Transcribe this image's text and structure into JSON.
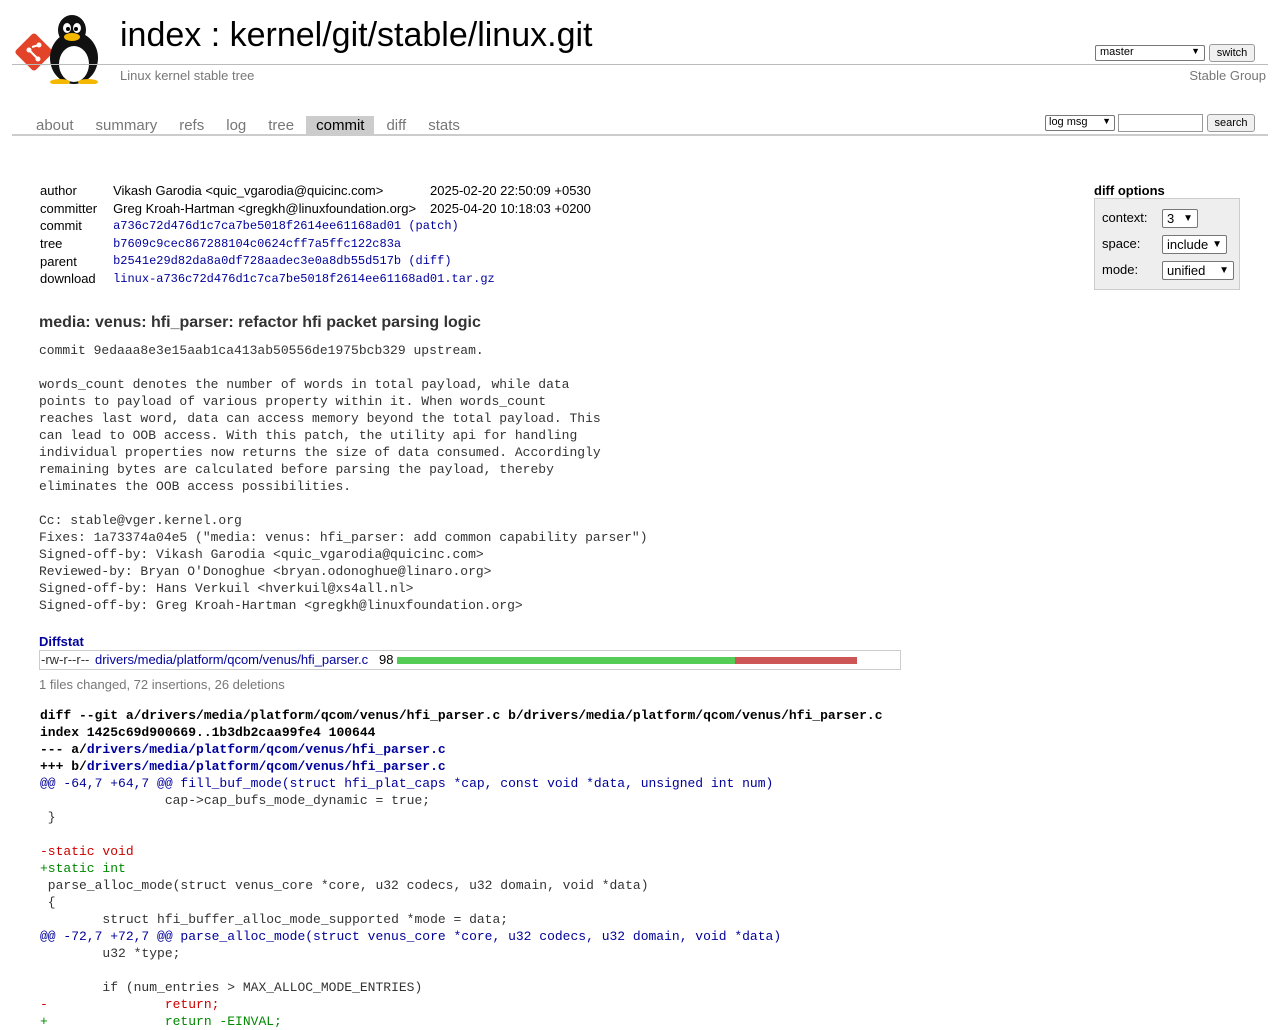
{
  "header": {
    "title_index": "index",
    "title_sep": " : ",
    "title_repo": "kernel/git/stable/linux.git",
    "subtitle": "Linux kernel stable tree",
    "owner": "Stable Group",
    "branch": "master",
    "switch_label": "switch"
  },
  "tabs": [
    {
      "label": "about"
    },
    {
      "label": "summary"
    },
    {
      "label": "refs"
    },
    {
      "label": "log"
    },
    {
      "label": "tree"
    },
    {
      "label": "commit",
      "active": true
    },
    {
      "label": "diff"
    },
    {
      "label": "stats"
    }
  ],
  "search": {
    "type": "log msg",
    "query": "",
    "button": "search"
  },
  "commit_info": [
    {
      "label": "author",
      "value": "Vikash Garodia <quic_vgarodia@quicinc.com>",
      "date": "2025-02-20 22:50:09 +0530"
    },
    {
      "label": "committer",
      "value": "Greg Kroah-Hartman <gregkh@linuxfoundation.org>",
      "date": "2025-04-20 10:18:03 +0200"
    },
    {
      "label": "commit",
      "hash": "a736c72d476d1c7ca7be5018f2614ee61168ad01",
      "extra": "(patch)"
    },
    {
      "label": "tree",
      "hash": "b7609c9cec867288104c0624cff7a5ffc122c83a"
    },
    {
      "label": "parent",
      "hash": "b2541e29d82da8a0df728aadec3e0a8db55d517b",
      "extra": "(diff)"
    },
    {
      "label": "download",
      "hash": "linux-a736c72d476d1c7ca7be5018f2614ee61168ad01.tar.gz"
    }
  ],
  "diff_options": {
    "title": "diff options",
    "context_label": "context:",
    "context_value": "3",
    "space_label": "space:",
    "space_value": "include",
    "mode_label": "mode:",
    "mode_value": "unified"
  },
  "subject": "media: venus: hfi_parser: refactor hfi packet parsing logic",
  "message": "commit 9edaaa8e3e15aab1ca413ab50556de1975bcb329 upstream.\n\nwords_count denotes the number of words in total payload, while data\npoints to payload of various property within it. When words_count\nreaches last word, data can access memory beyond the total payload. This\ncan lead to OOB access. With this patch, the utility api for handling\nindividual properties now returns the size of data consumed. Accordingly\nremaining bytes are calculated before parsing the payload, thereby\neliminates the OOB access possibilities.\n\nCc: stable@vger.kernel.org\nFixes: 1a73374a04e5 (\"media: venus: hfi_parser: add common capability parser\")\nSigned-off-by: Vikash Garodia <quic_vgarodia@quicinc.com>\nReviewed-by: Bryan O'Donoghue <bryan.odonoghue@linaro.org>\nSigned-off-by: Hans Verkuil <hverkuil@xs4all.nl>\nSigned-off-by: Greg Kroah-Hartman <gregkh@linuxfoundation.org>",
  "diffstat": {
    "header": "Diffstat",
    "mode": "-rw-r--r--",
    "file": "drivers/media/platform/qcom/venus/hfi_parser.c",
    "count": "98",
    "insertions": 72,
    "deletions": 26,
    "summary": "1 files changed, 72 insertions, 26 deletions"
  },
  "diff_lines": [
    {
      "type": "hdr",
      "text": "diff --git a/drivers/media/platform/qcom/venus/hfi_parser.c b/drivers/media/platform/qcom/venus/hfi_parser.c"
    },
    {
      "type": "hdr",
      "text": "index 1425c69d900669..1b3db2caa99fe4 100644"
    },
    {
      "type": "hdr",
      "prefix": "--- a/",
      "path": "drivers/media/platform/qcom/venus/hfi_parser.c"
    },
    {
      "type": "hdr",
      "prefix": "+++ b/",
      "path": "drivers/media/platform/qcom/venus/hfi_parser.c"
    },
    {
      "type": "hunk",
      "text": "@@ -64,7 +64,7 @@ fill_buf_mode(struct hfi_plat_caps *cap, const void *data, unsigned int num)"
    },
    {
      "type": "ctx",
      "text": " \t\tcap->cap_bufs_mode_dynamic = true;"
    },
    {
      "type": "ctx",
      "text": " }"
    },
    {
      "type": "ctx",
      "text": " "
    },
    {
      "type": "del",
      "text": "-static void"
    },
    {
      "type": "add",
      "text": "+static int"
    },
    {
      "type": "ctx",
      "text": " parse_alloc_mode(struct venus_core *core, u32 codecs, u32 domain, void *data)"
    },
    {
      "type": "ctx",
      "text": " {"
    },
    {
      "type": "ctx",
      "text": " \tstruct hfi_buffer_alloc_mode_supported *mode = data;"
    },
    {
      "type": "hunk",
      "text": "@@ -72,7 +72,7 @@ parse_alloc_mode(struct venus_core *core, u32 codecs, u32 domain, void *data)"
    },
    {
      "type": "ctx",
      "text": " \tu32 *type;"
    },
    {
      "type": "ctx",
      "text": " "
    },
    {
      "type": "ctx",
      "text": " \tif (num_entries > MAX_ALLOC_MODE_ENTRIES)"
    },
    {
      "type": "del",
      "text": "-\t\treturn;"
    },
    {
      "type": "add",
      "text": "+\t\treturn -EINVAL;"
    }
  ],
  "colors": {
    "link": "#00009c",
    "insert_bar": "#55cc55",
    "delete_bar": "#cc5555",
    "active_tab": "#cccccc"
  }
}
